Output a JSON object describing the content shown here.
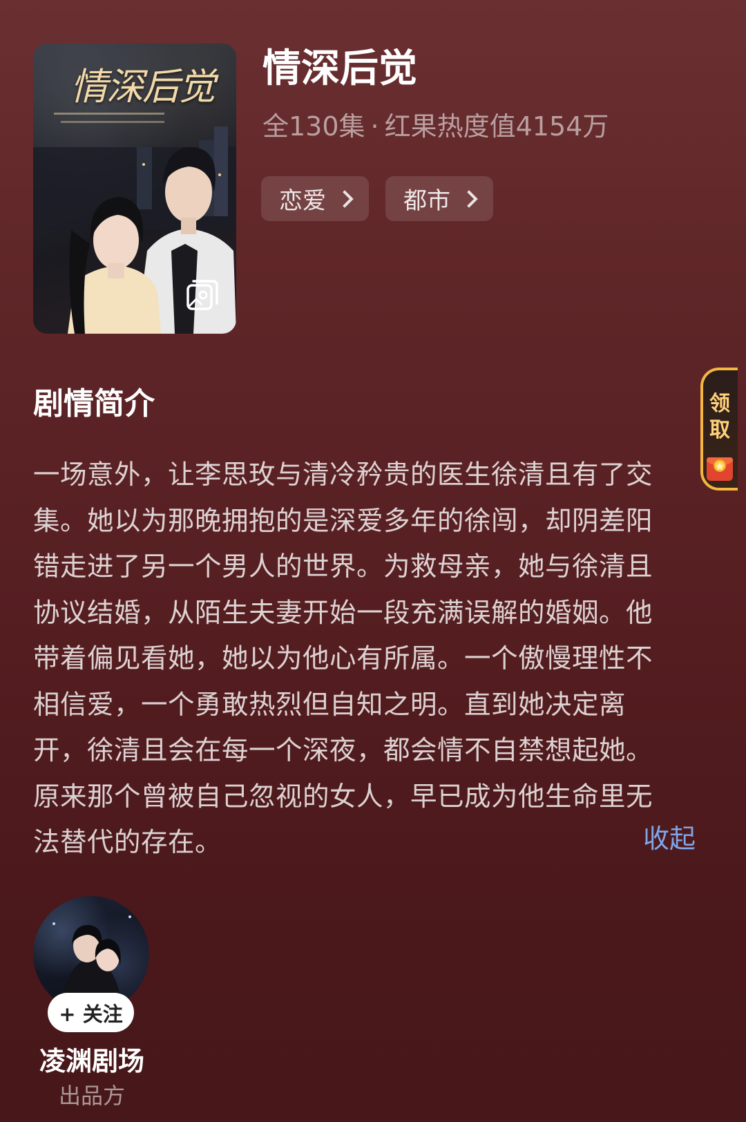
{
  "show": {
    "title": "情深后觉",
    "episodes": "全130集",
    "separator": "·",
    "heat": "红果热度值4154万",
    "cover_title": "情深后觉"
  },
  "tags": [
    {
      "label": "恋爱"
    },
    {
      "label": "都市"
    }
  ],
  "synopsis": {
    "heading": "剧情简介",
    "lines": [
      "一场意外，让李思玫与清冷矜贵的医生徐清且有了交",
      "集。她以为那晚拥抱的是深爱多年的徐闯，却阴差阳",
      "错走进了另一个男人的世界。为救母亲，她与徐清且",
      "协议结婚，从陌生夫妻开始一段充满误解的婚姻。他",
      "带着偏见看她，她以为他心有所属。一个傲慢理性不",
      "相信爱，一个勇敢热烈但自知之明。直到她决定离",
      "开，徐清且会在每一个深夜，都会情不自禁想起她。",
      "原来那个曾被自己忽视的女人，早已成为他生命里无",
      "法替代的存在。"
    ],
    "collapse_label": "收起"
  },
  "reward": {
    "line1": "领",
    "line2": "取"
  },
  "producer": {
    "follow_label": "+ 关注",
    "name": "凌渊剧场",
    "role": "出品方"
  },
  "colors": {
    "background_top": "#6a2f31",
    "background_bottom": "#47171a",
    "link": "#7fa6e8",
    "reward_border": "#f3b740"
  }
}
